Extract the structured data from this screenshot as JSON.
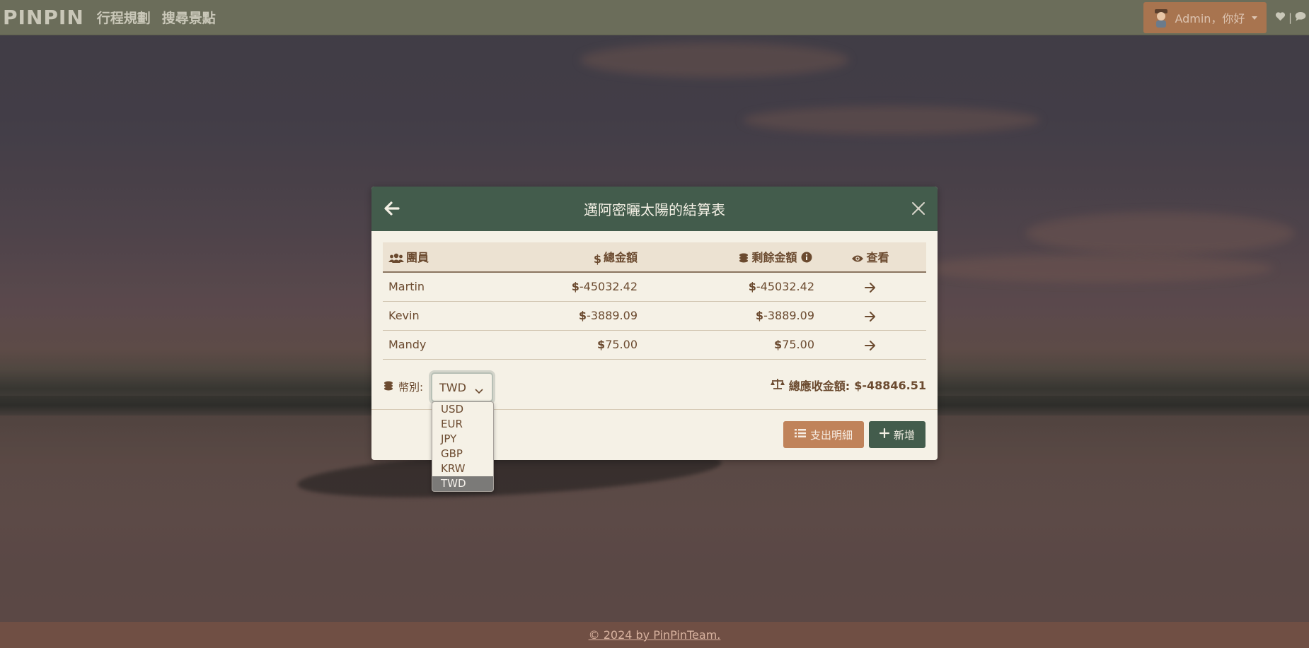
{
  "navbar": {
    "brand": "PINPIN",
    "links": [
      "行程規劃",
      "搜尋景點"
    ],
    "user_label": "Admin，你好",
    "icons": [
      "user-avatar-icon",
      "heart-icon",
      "chat-icon"
    ]
  },
  "modal": {
    "title": "邁阿密曬太陽的結算表",
    "columns": {
      "member": "團員",
      "total": "總金額",
      "remaining": "剩餘金額",
      "view": "查看"
    },
    "rows": [
      {
        "name": "Martin",
        "total": "-45032.42",
        "remaining": "-45032.42"
      },
      {
        "name": "Kevin",
        "total": "-3889.09",
        "remaining": "-3889.09"
      },
      {
        "name": "Mandy",
        "total": "75.00",
        "remaining": "75.00"
      }
    ],
    "currency_symbol": "$",
    "currency_label": "幣別:",
    "currency_selected": "TWD",
    "currency_options": [
      "USD",
      "EUR",
      "JPY",
      "GBP",
      "KRW",
      "TWD"
    ],
    "total_due_label": "總應收金額:",
    "total_due_value": "-48846.51",
    "buttons": {
      "expense_details": "支出明細",
      "add": "新增"
    }
  },
  "footer": {
    "copyright": "© 2024 by PinPinTeam."
  },
  "colors": {
    "primary_green": "#435c4c",
    "accent_orange": "#c0835a",
    "text_brown": "#6b4a2f",
    "navbar": "#6b6d5a",
    "footer": "#704f44"
  }
}
